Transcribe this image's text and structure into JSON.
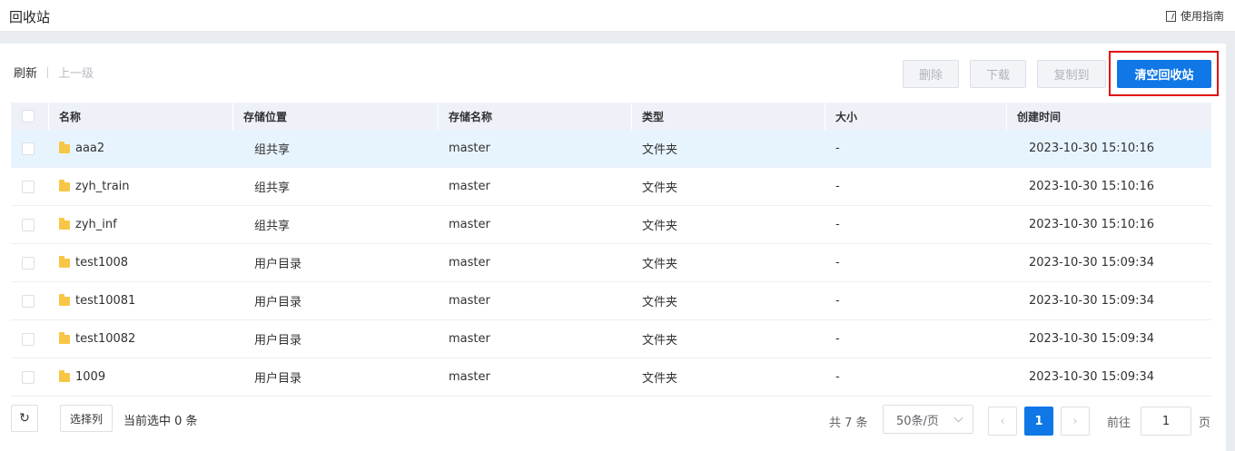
{
  "header": {
    "title": "回收站",
    "guide_label": "使用指南"
  },
  "toolbar": {
    "refresh_label": "刷新",
    "up_label": "上一级",
    "delete_label": "删除",
    "download_label": "下载",
    "copy_label": "复制到",
    "clear_label": "清空回收站"
  },
  "table": {
    "columns": [
      "名称",
      "存储位置",
      "存储名称",
      "类型",
      "大小",
      "创建时间"
    ],
    "rows": [
      {
        "name": "aaa2",
        "location": "组共享",
        "storage": "master",
        "type": "文件夹",
        "size": "-",
        "created": "2023-10-30 15:10:16"
      },
      {
        "name": "zyh_train",
        "location": "组共享",
        "storage": "master",
        "type": "文件夹",
        "size": "-",
        "created": "2023-10-30 15:10:16"
      },
      {
        "name": "zyh_inf",
        "location": "组共享",
        "storage": "master",
        "type": "文件夹",
        "size": "-",
        "created": "2023-10-30 15:10:16"
      },
      {
        "name": "test1008",
        "location": "用户目录",
        "storage": "master",
        "type": "文件夹",
        "size": "-",
        "created": "2023-10-30 15:09:34"
      },
      {
        "name": "test10081",
        "location": "用户目录",
        "storage": "master",
        "type": "文件夹",
        "size": "-",
        "created": "2023-10-30 15:09:34"
      },
      {
        "name": "test10082",
        "location": "用户目录",
        "storage": "master",
        "type": "文件夹",
        "size": "-",
        "created": "2023-10-30 15:09:34"
      },
      {
        "name": "1009",
        "location": "用户目录",
        "storage": "master",
        "type": "文件夹",
        "size": "-",
        "created": "2023-10-30 15:09:34"
      }
    ]
  },
  "footer": {
    "refresh_icon": "refresh-icon",
    "select_columns_label": "选择列",
    "selected_text": "当前选中 0 条",
    "total_text": "共 7 条",
    "page_size": "50条/页",
    "current_page": "1",
    "goto_label": "前往",
    "goto_value": "1",
    "page_unit": "页"
  },
  "colors": {
    "accent": "#0f77e6",
    "highlight": "#e00d0d",
    "header_bg": "#eef2f8"
  }
}
